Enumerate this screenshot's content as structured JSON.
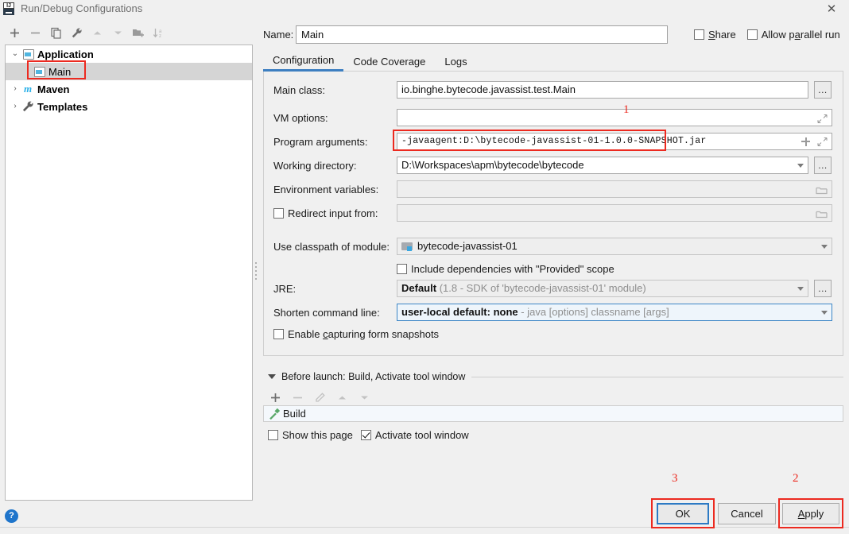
{
  "window": {
    "title": "Run/Debug Configurations",
    "app_icon": "intellij-idea-icon",
    "close_label": "✕"
  },
  "left_panel": {
    "toolbar": [
      {
        "name": "add-configuration-button",
        "icon": "plus-icon",
        "label": "+"
      },
      {
        "name": "remove-configuration-button",
        "icon": "minus-icon",
        "label": "−"
      },
      {
        "name": "copy-configuration-button",
        "icon": "copy-icon",
        "label": ""
      },
      {
        "name": "edit-templates-button",
        "icon": "wrench-icon",
        "label": ""
      },
      {
        "name": "move-up-button",
        "icon": "arrow-up-icon",
        "label": ""
      },
      {
        "name": "move-down-button",
        "icon": "arrow-down-icon",
        "label": ""
      },
      {
        "name": "new-folder-button",
        "icon": "folder-add-icon",
        "label": ""
      },
      {
        "name": "sort-alphabetically-button",
        "icon": "sort-az-icon",
        "label": ""
      }
    ],
    "tree": [
      {
        "label": "Application",
        "icon": "application-icon",
        "twisty": "⌄",
        "expanded": true,
        "level": 0,
        "selected": false
      },
      {
        "label": "Main",
        "icon": "application-icon",
        "twisty": "",
        "expanded": false,
        "level": 1,
        "selected": true
      },
      {
        "label": "Maven",
        "icon": "maven-icon",
        "twisty": "›",
        "expanded": false,
        "level": 0,
        "selected": false
      },
      {
        "label": "Templates",
        "icon": "wrench-icon",
        "twisty": "›",
        "expanded": false,
        "level": 0,
        "selected": false
      }
    ],
    "help_button": "?"
  },
  "header": {
    "name_label": "Name:",
    "name_value": "Main",
    "name_placeholder": "",
    "share_label": "Share",
    "share_checked": false,
    "allow_parallel_label": "Allow parallel run",
    "allow_parallel_checked": false
  },
  "tabs": [
    {
      "label": "Configuration",
      "active": true
    },
    {
      "label": "Code Coverage",
      "active": false
    },
    {
      "label": "Logs",
      "active": false
    }
  ],
  "configuration": {
    "main_class": {
      "label": "Main class:",
      "value": "io.binghe.bytecode.javassist.test.Main",
      "browse_label": "...",
      "browse_icon": "ellipsis-icon"
    },
    "vm_options": {
      "label": "VM options:",
      "value": "",
      "placeholder": "",
      "expand_icon": "expand-icon"
    },
    "program_arguments": {
      "label": "Program arguments:",
      "value": "-javaagent:D:\\bytecode-javassist-01-1.0.0-SNAPSHOT.jar",
      "insert_macro_icon": "plus-icon",
      "expand_icon": "expand-icon"
    },
    "working_directory": {
      "label": "Working directory:",
      "value": "D:\\Workspaces\\apm\\bytecode\\bytecode",
      "dropdown_icon": "chevron-down-icon",
      "browse_label": "...",
      "browse_icon": "ellipsis-icon"
    },
    "environment_variables": {
      "label": "Environment variables:",
      "value": "",
      "browse_icon": "folder-icon"
    },
    "redirect_input": {
      "label": "Redirect input from:",
      "checked": false,
      "value": "",
      "browse_icon": "folder-icon"
    },
    "use_classpath_of_module": {
      "label": "Use classpath of module:",
      "value": "bytecode-javassist-01",
      "module_icon": "module-icon",
      "dropdown_icon": "chevron-down-icon"
    },
    "include_provided": {
      "label": "Include dependencies with \"Provided\" scope",
      "checked": false
    },
    "jre": {
      "label": "JRE:",
      "value_bold": "Default",
      "value_grey": "(1.8 - SDK of 'bytecode-javassist-01' module)",
      "dropdown_icon": "chevron-down-icon",
      "browse_label": "...",
      "browse_icon": "ellipsis-icon"
    },
    "shorten_command_line": {
      "label": "Shorten command line:",
      "value_bold": "user-local default: none",
      "value_grey": "- java [options] classname [args]",
      "dropdown_icon": "chevron-down-icon"
    },
    "enable_form_snapshots": {
      "label_before": "Enable ",
      "label_underline": "c",
      "label_after": "apturing form snapshots",
      "label": "Enable capturing form snapshots",
      "checked": false
    }
  },
  "before_launch": {
    "header": "Before launch: Build, Activate tool window",
    "collapse_icon": "triangle-down-icon",
    "toolbar": [
      {
        "name": "add-task-button",
        "icon": "plus-icon",
        "label": "+",
        "enabled": true
      },
      {
        "name": "remove-task-button",
        "icon": "minus-icon",
        "label": "−",
        "enabled": false
      },
      {
        "name": "edit-task-button",
        "icon": "pencil-icon",
        "label": "",
        "enabled": false
      },
      {
        "name": "move-task-up-button",
        "icon": "arrow-up-icon",
        "label": "",
        "enabled": false
      },
      {
        "name": "move-task-down-button",
        "icon": "arrow-down-icon",
        "label": "",
        "enabled": false
      }
    ],
    "tasks": [
      {
        "label": "Build",
        "icon": "build-hammer-icon"
      }
    ],
    "show_this_page": {
      "label": "Show this page",
      "checked": false
    },
    "activate_tool_window": {
      "label": "Activate tool window",
      "checked": true
    }
  },
  "buttons": {
    "ok": "OK",
    "cancel": "Cancel",
    "apply": "Apply"
  },
  "annotations": [
    {
      "number": "1",
      "target": "program-arguments-field"
    },
    {
      "number": "2",
      "target": "apply-button"
    },
    {
      "number": "3",
      "target": "ok-button"
    }
  ],
  "colors": {
    "annotation_red": "#ec2a20",
    "accent_blue": "#3d7fc1",
    "focus_blue": "#2d7ac4",
    "help_blue": "#1f75cb",
    "selection_grey": "#d5d5d5"
  }
}
